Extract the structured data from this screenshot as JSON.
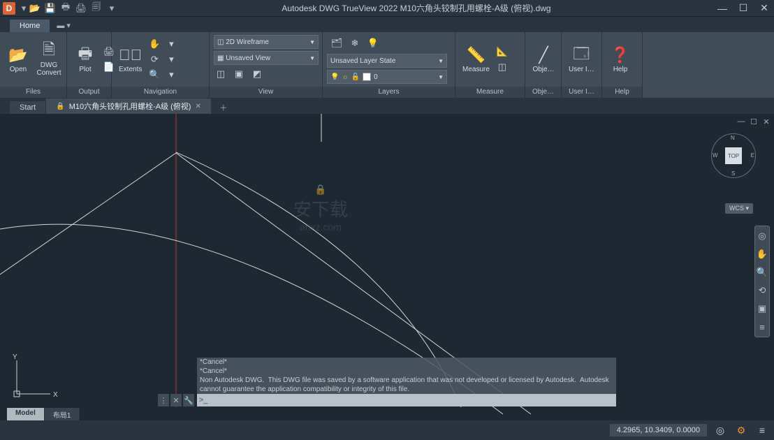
{
  "app": {
    "logo_letter": "D",
    "title": "Autodesk DWG TrueView 2022     M10六角头铰制孔用螺栓-A级 (俯视).dwg"
  },
  "tabs": {
    "home": "Home",
    "ext": "▬ ▾"
  },
  "ribbon": {
    "files": {
      "label": "Files",
      "open": "Open",
      "convert": "DWG\nConvert"
    },
    "output": {
      "label": "Output",
      "plot": "Plot"
    },
    "navigation": {
      "label": "Navigation",
      "extents": "Extents"
    },
    "view": {
      "label": "View",
      "visual_style": "2D Wireframe",
      "named_view": "Unsaved View"
    },
    "layers": {
      "label": "Layers",
      "state": "Unsaved Layer State",
      "current": "0"
    },
    "measure": {
      "label": "Measure",
      "btn": "Measure"
    },
    "objects": {
      "label": "Obje…",
      "btn": "Obje…"
    },
    "ui": {
      "label": "User I…",
      "btn": "User I…"
    },
    "help": {
      "label": "Help",
      "btn": "Help"
    }
  },
  "doctabs": {
    "start": "Start",
    "active": "M10六角头铰制孔用螺栓-A级 (俯视)"
  },
  "viewcube": {
    "top": "TOP",
    "n": "N",
    "s": "S",
    "e": "E",
    "w": "W",
    "wcs": "WCS"
  },
  "cmd": {
    "history": [
      "*Cancel*",
      "*Cancel*",
      "Non Autodesk DWG.  This DWG file was saved by a software application that was not developed or licensed by Autodesk.  Autodesk cannot guarantee the application compatibility or integrity of this file."
    ],
    "prompt": ">_"
  },
  "layouts": {
    "model": "Model",
    "layout1": "布局1"
  },
  "status": {
    "coords": "4.2965, 10.3409, 0.0000"
  },
  "watermark": {
    "line1": "安下载",
    "line2": "anxz.com"
  }
}
